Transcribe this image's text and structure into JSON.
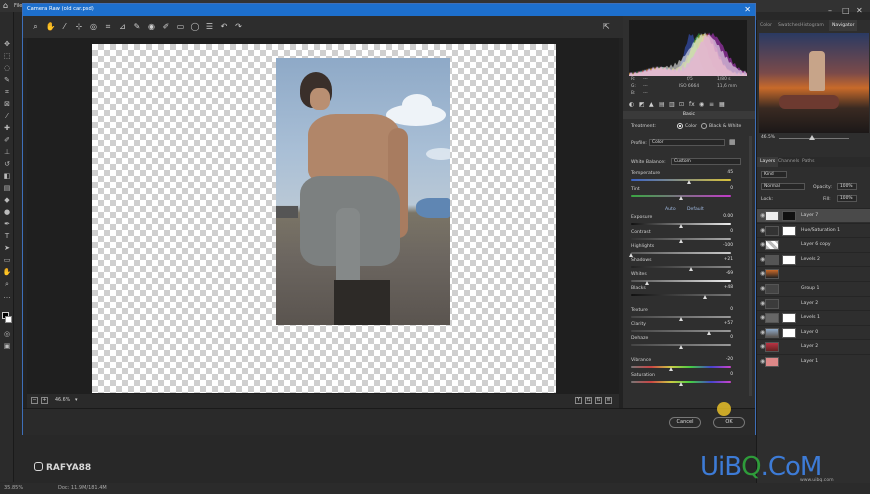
{
  "photoshop": {
    "menu_left": "File",
    "layer_tabs": [
      "Layers",
      "Channels",
      "Paths"
    ],
    "nav_tabs": [
      "Color",
      "Swatches",
      "Histogram",
      "Navigator"
    ],
    "nav_zoom": "46.5%",
    "kind_label": "Kind",
    "blend_mode": "Normal",
    "opacity_label": "Opacity:",
    "opacity_value": "100%",
    "lock_label": "Lock:",
    "fill_label": "Fill:",
    "fill_value": "100%",
    "layers": [
      "Layer 7",
      "Hue/Saturation 1",
      "Layer 6 copy",
      "Levels 2",
      "",
      "Group 1",
      "Layer 2",
      "Levels 1",
      "Layer 0",
      "Layer 2",
      "Layer 1"
    ],
    "status_zoom": "35.85%",
    "status_doc": "Doc: 11.9M/181.4M"
  },
  "camera_raw": {
    "title": "Camera Raw (old car.psd)",
    "zoom_level": "46.6%",
    "toolbar_icons": [
      "zoom-icon",
      "hand-icon",
      "white-balance-icon",
      "color-sampler-icon",
      "targeted-adjust-icon",
      "crop-icon",
      "straighten-icon",
      "spot-removal-icon",
      "red-eye-icon",
      "adjustment-brush-icon",
      "graduated-filter-icon",
      "radial-filter-icon",
      "preferences-icon",
      "rotate-left-icon",
      "rotate-right-icon"
    ],
    "rgb": {
      "r_label": "R:",
      "g_label": "G:",
      "b_label": "B:",
      "r": "---",
      "g": "---",
      "b": "---",
      "aperture": "f/5",
      "shutter": "1/80 s",
      "iso": "ISO 6664",
      "focal": "11,6 mm"
    },
    "panel_title": "Basic",
    "treatment_label": "Treatment:",
    "treatment_color": "Color",
    "treatment_bw": "Black & White",
    "profile_label": "Profile:",
    "profile_value": "Color",
    "white_balance_label": "White Balance:",
    "white_balance_value": "Custom",
    "auto_label": "Auto",
    "default_label": "Default",
    "sliders": [
      {
        "label": "Temperature",
        "value": "45",
        "pos": 0.58,
        "gradient": "linear-gradient(90deg,#3b63c6,#d9c23a)"
      },
      {
        "label": "Tint",
        "value": "0",
        "pos": 0.5,
        "gradient": "linear-gradient(90deg,#3aa642,#c23ac8)"
      },
      {
        "label": "Exposure",
        "value": "0.00",
        "pos": 0.5,
        "gradient": "linear-gradient(90deg,#111,#eee)"
      },
      {
        "label": "Contrast",
        "value": "0",
        "pos": 0.5,
        "gradient": "linear-gradient(90deg,#333,#aaa)"
      },
      {
        "label": "Highlights",
        "value": "-100",
        "pos": 0.0,
        "gradient": "linear-gradient(90deg,#555,#ccc)"
      },
      {
        "label": "Shadows",
        "value": "+21",
        "pos": 0.6,
        "gradient": "linear-gradient(90deg,#222,#888)"
      },
      {
        "label": "Whites",
        "value": "-69",
        "pos": 0.16,
        "gradient": "linear-gradient(90deg,#555,#eee)"
      },
      {
        "label": "Blacks",
        "value": "+48",
        "pos": 0.74,
        "gradient": "linear-gradient(90deg,#111,#777)"
      },
      {
        "label": "Texture",
        "value": "0",
        "pos": 0.5,
        "gradient": "linear-gradient(90deg,#444,#999)"
      },
      {
        "label": "Clarity",
        "value": "+57",
        "pos": 0.78,
        "gradient": "linear-gradient(90deg,#444,#999)"
      },
      {
        "label": "Dehaze",
        "value": "0",
        "pos": 0.5,
        "gradient": "linear-gradient(90deg,#444,#999)"
      },
      {
        "label": "Vibrance",
        "value": "-20",
        "pos": 0.4,
        "gradient": "linear-gradient(90deg,#777,#c44,#cc4,#4c4,#44c,#c4c)"
      },
      {
        "label": "Saturation",
        "value": "0",
        "pos": 0.5,
        "gradient": "linear-gradient(90deg,#777,#c44,#cc4,#4c4,#44c,#c4c)"
      }
    ],
    "cancel_label": "Cancel",
    "ok_label": "OK"
  },
  "watermarks": {
    "instagram": "RAFYA88",
    "site_u": "UiB",
    "site_q": "Q",
    "site_dot": ".",
    "site_com": "CoM",
    "site_url": "www.uibq.com"
  },
  "colors": {
    "titlebar": "#1d6fcc",
    "accent_blue": "#3d7bd6",
    "accent_green": "#2e9c3a"
  }
}
